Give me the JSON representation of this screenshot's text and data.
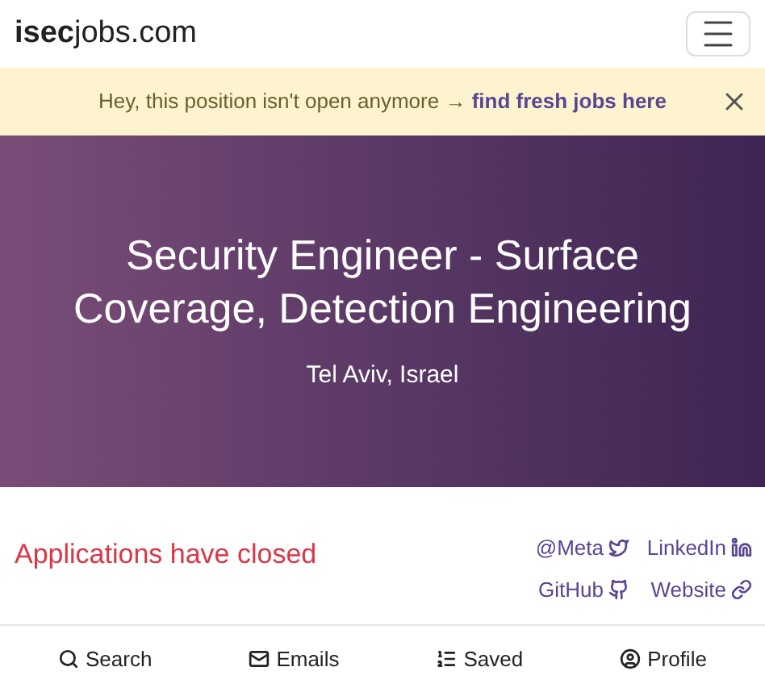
{
  "header": {
    "logo_bold": "isec",
    "logo_rest": "jobs.com"
  },
  "banner": {
    "message": "Hey, this position isn't open anymore →",
    "link": "find fresh jobs here"
  },
  "hero": {
    "title": "Security Engineer - Surface Coverage, Detection Engineering",
    "location": "Tel Aviv, Israel"
  },
  "status": "Applications have closed",
  "links": [
    {
      "label": "@Meta",
      "kind": "twitter"
    },
    {
      "label": "LinkedIn",
      "kind": "linkedin"
    },
    {
      "label": "GitHub",
      "kind": "github"
    },
    {
      "label": "Website",
      "kind": "website"
    }
  ],
  "bottom_nav": [
    {
      "label": "Search",
      "kind": "search"
    },
    {
      "label": "Emails",
      "kind": "emails"
    },
    {
      "label": "Saved",
      "kind": "saved"
    },
    {
      "label": "Profile",
      "kind": "profile"
    }
  ]
}
